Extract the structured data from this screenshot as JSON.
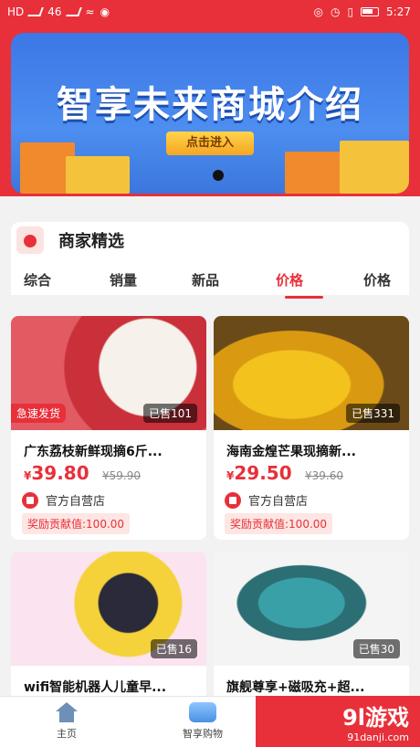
{
  "status_bar": {
    "left_labels": [
      "HD",
      "46",
      "46"
    ],
    "time": "5:27"
  },
  "banner": {
    "title": "智享未来商城介绍",
    "button_label": "点击进入"
  },
  "section": {
    "title": "商家精选",
    "tabs": [
      "综合",
      "销量",
      "新品",
      "价格",
      "价格"
    ],
    "active_tab": "价格"
  },
  "products": [
    {
      "name": "广东荔枝新鲜现摘6斤...",
      "price_symbol": "¥",
      "price": "39.80",
      "original_price": "¥59.90",
      "sold": "已售101",
      "shop": "官方自营店",
      "reward": "奖励贡献值:100.00",
      "badge": "急速发货"
    },
    {
      "name": "海南金煌芒果现摘新...",
      "price_symbol": "¥",
      "price": "29.50",
      "original_price": "¥39.60",
      "sold": "已售331",
      "shop": "官方自营店",
      "reward": "奖励贡献值:100.00",
      "badge": ""
    },
    {
      "name": "wifi智能机器人儿童早...",
      "price_symbol": "¥",
      "price": "",
      "original_price": "",
      "sold": "已售16",
      "shop": "",
      "reward": "",
      "badge": ""
    },
    {
      "name": "旗舰尊享+磁吸充+超...",
      "price_symbol": "¥",
      "price": "",
      "original_price": "",
      "sold": "已售30",
      "shop": "",
      "reward": "",
      "badge": ""
    }
  ],
  "bottom_nav": {
    "items": [
      "主页",
      "智享购物"
    ]
  },
  "watermark": {
    "big": "9l游戏",
    "small": "91danji.com"
  },
  "colors": {
    "accent": "#e8303a",
    "banner_blue": "#3c77e6"
  }
}
